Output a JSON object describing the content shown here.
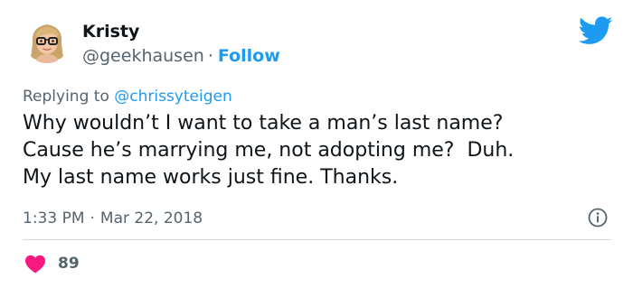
{
  "author": {
    "name": "Kristy",
    "handle": "@geekhausen",
    "separator": "·",
    "follow_label": "Follow",
    "avatar_icon": "memoji-avatar-with-glasses"
  },
  "brand": {
    "icon": "twitter-bird-icon",
    "color": "#1d9bf0"
  },
  "reply": {
    "prefix": "Replying to",
    "mention": "@chrissyteigen"
  },
  "tweet": {
    "lines": [
      "Why wouldn’t I want to take a man’s last name?",
      "Cause he’s marrying me, not adopting me?  Duh.",
      "My last name works just fine. Thanks."
    ]
  },
  "meta": {
    "time": "1:33 PM",
    "separator": "·",
    "date": "Mar 22, 2018",
    "info_icon": "info-icon"
  },
  "engagement": {
    "likes": "89",
    "like_icon": "heart-icon",
    "like_color": "#f91880"
  },
  "colors": {
    "text": "#0f1419",
    "secondary": "#536471",
    "accent": "#1d9bf0",
    "divider": "#cfd9de"
  }
}
